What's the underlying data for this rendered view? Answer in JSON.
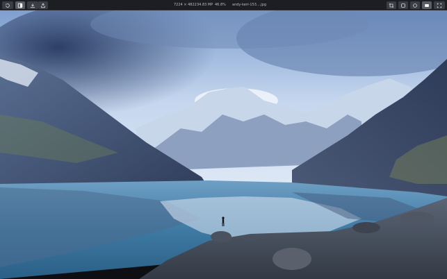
{
  "toolbar": {
    "left_icons": [
      "history-icon",
      "compare-icon",
      "download-icon",
      "share-icon"
    ],
    "right_icons": [
      "crop-icon",
      "adjust-icon",
      "circle-icon",
      "fullscreen-icon",
      "expand-icon"
    ]
  },
  "info": {
    "dimensions": "7224 × 4822",
    "megapixels": "34.83 MP",
    "zoom": "46.8%",
    "filename": "andy-kerr-153....jpg"
  },
  "colors": {
    "toolbar_bg": "#1c1e22",
    "button_bg": "#3a3d43",
    "button_active": "#5a5e66",
    "text": "#b9bdc5"
  }
}
